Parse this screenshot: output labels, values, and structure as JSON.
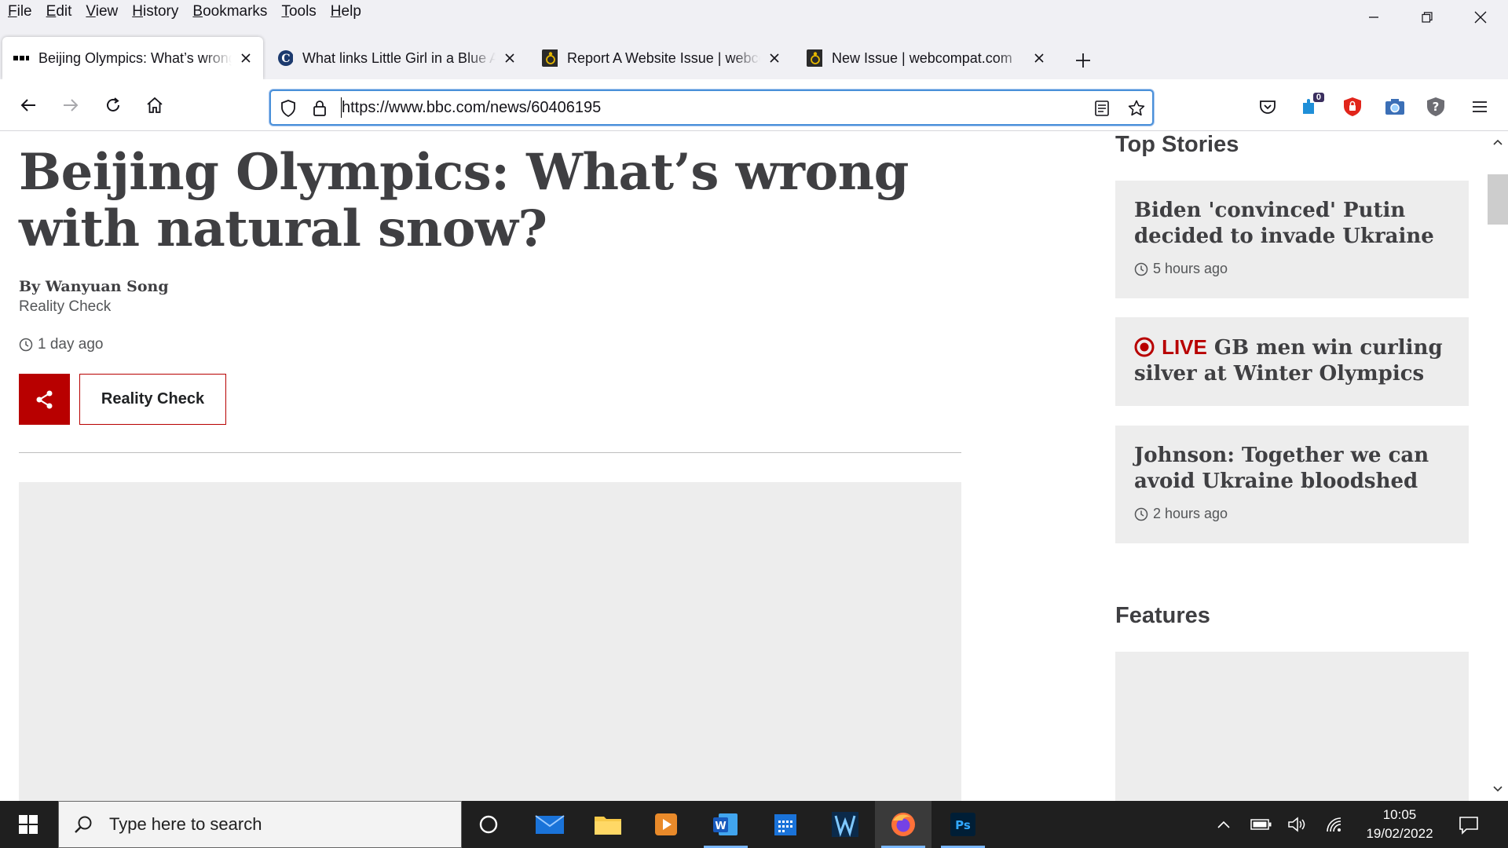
{
  "menubar": {
    "items": [
      {
        "label": "File",
        "ul": "F",
        "rest": "ile"
      },
      {
        "label": "Edit",
        "ul": "E",
        "rest": "dit"
      },
      {
        "label": "View",
        "ul": "V",
        "rest": "iew"
      },
      {
        "label": "History",
        "ul": "H",
        "rest": "istory"
      },
      {
        "label": "Bookmarks",
        "ul": "B",
        "rest": "ookmarks"
      },
      {
        "label": "Tools",
        "ul": "T",
        "rest": "ools"
      },
      {
        "label": "Help",
        "ul": "H",
        "rest": "elp"
      }
    ]
  },
  "tabs": [
    {
      "title": "Beijing Olympics: What’s wrong with natural snow?",
      "icon": "bbc-icon",
      "active": true
    },
    {
      "title": "What links Little Girl in a Blue Armchair",
      "icon": "wikipedia-icon",
      "active": false
    },
    {
      "title": "Report A Website Issue | webcompat.com",
      "icon": "webcompat-icon",
      "active": false
    },
    {
      "title": "New Issue | webcompat.com",
      "icon": "webcompat-icon",
      "active": false
    }
  ],
  "navbar": {
    "url": "https://www.bbc.com/news/60406195",
    "extension_badge": "0"
  },
  "article": {
    "headline": "Beijing Olympics: What’s wrong with natural snow?",
    "byline": "By Wanyuan Song",
    "byline_role": "Reality Check",
    "timestamp": "1 day ago",
    "topic_button": "Reality Check"
  },
  "sidebar": {
    "top_stories_heading": "Top Stories",
    "stories": [
      {
        "title": "Biden 'convinced' Putin decided to invade Ukraine",
        "time": "5 hours ago"
      },
      {
        "live_label": "LIVE",
        "title": "GB men win curling silver at Winter Olympics"
      },
      {
        "title": "Johnson: Together we can avoid Ukraine bloodshed",
        "time": "2 hours ago"
      }
    ],
    "features_heading": "Features"
  },
  "taskbar": {
    "search_placeholder": "Type here to search",
    "time": "10:05",
    "date": "19/02/2022"
  },
  "colors": {
    "bbc_red": "#b80000",
    "url_focus": "#4a90d9",
    "taskbar": "#1f1f1f"
  }
}
